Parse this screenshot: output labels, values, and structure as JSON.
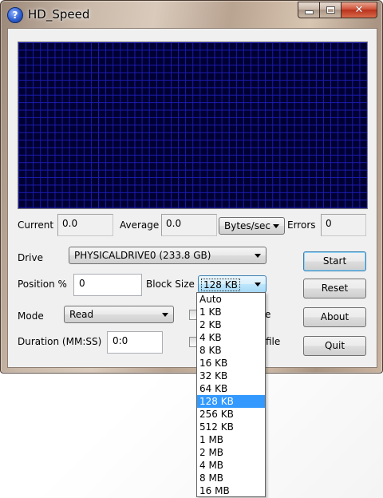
{
  "window": {
    "title": "HD_Speed",
    "icon": "question-icon",
    "icon_glyph": "?",
    "controls": {
      "minimize": "minimize-icon",
      "maximize": "maximize-icon",
      "close": "✕"
    }
  },
  "stats": {
    "current_label": "Current",
    "current_value": "0.0",
    "average_label": "Average",
    "average_value": "0.0",
    "unit_selected": "Bytes/sec",
    "errors_label": "Errors",
    "errors_value": "0"
  },
  "form": {
    "drive_label": "Drive",
    "drive_value": "PHYSICALDRIVE0 (233.8 GB)",
    "position_label": "Position %",
    "position_value": "0",
    "block_size_label": "Block Size",
    "block_size_value": "128 KB",
    "mode_label": "Mode",
    "mode_value": "Read",
    "duration_label": "Duration (MM:SS)",
    "duration_value": "0:0",
    "checkbox1_label_visible": "e",
    "checkbox2_label_visible": "file"
  },
  "buttons": {
    "start": "Start",
    "reset": "Reset",
    "about": "About",
    "quit": "Quit"
  },
  "block_size_options": [
    "Auto",
    "1 KB",
    "2 KB",
    "4 KB",
    "8 KB",
    "16 KB",
    "32 KB",
    "64 KB",
    "128 KB",
    "256 KB",
    "512 KB",
    "1 MB",
    "2 MB",
    "4 MB",
    "8 MB",
    "16 MB"
  ],
  "block_size_selected_index": 8,
  "colors": {
    "graph_background": "#000033",
    "graph_grid": "#1c1cb0",
    "selection": "#3399ff"
  }
}
